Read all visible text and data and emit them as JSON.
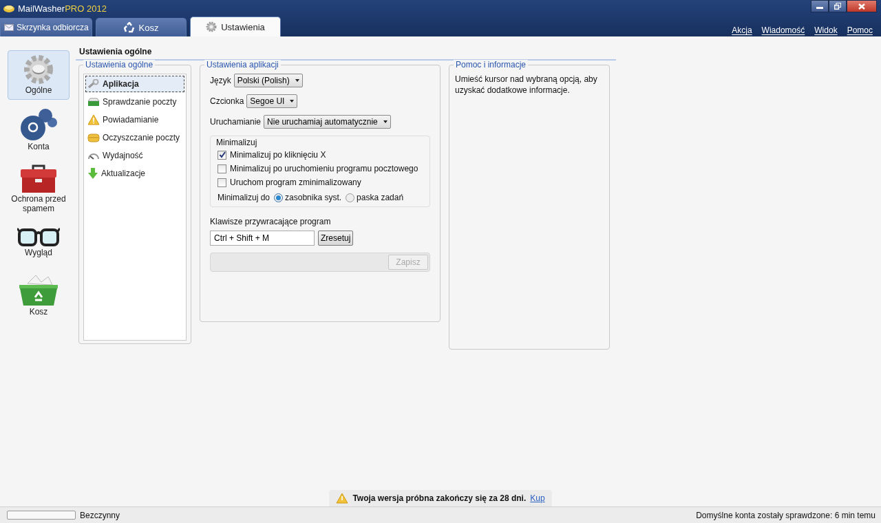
{
  "window": {
    "title_main": "MailWasher",
    "title_accent": "PRO 2012"
  },
  "tabs": [
    {
      "label": "Skrzynka odbiorcza",
      "selected": false
    },
    {
      "label": "Kosz",
      "selected": false
    },
    {
      "label": "Ustawienia",
      "selected": true
    }
  ],
  "menu": [
    "Akcja",
    "Wiadomość",
    "Widok",
    "Pomoc"
  ],
  "nav": [
    {
      "label": "Ogólne",
      "selected": true
    },
    {
      "label": "Konta",
      "selected": false
    },
    {
      "label": "Ochrona przed spamem",
      "selected": false
    },
    {
      "label": "Wygląd",
      "selected": false
    },
    {
      "label": "Kosz",
      "selected": false
    }
  ],
  "page_title": "Ustawienia ogólne",
  "categories": {
    "title": "Ustawienia ogólne",
    "items": [
      {
        "label": "Aplikacja",
        "selected": true
      },
      {
        "label": "Sprawdzanie poczty",
        "selected": false
      },
      {
        "label": "Powiadamianie",
        "selected": false
      },
      {
        "label": "Oczyszczanie poczty",
        "selected": false
      },
      {
        "label": "Wydajność",
        "selected": false
      },
      {
        "label": "Aktualizacje",
        "selected": false
      }
    ]
  },
  "app_settings": {
    "title": "Ustawienia aplikacji",
    "dropdowns": [
      {
        "label": "Język",
        "value": "Polski (Polish)"
      },
      {
        "label": "Czcionka",
        "value": "Segoe UI"
      },
      {
        "label": "Uruchamianie",
        "value": "Nie uruchamiaj automatycznie"
      }
    ],
    "minimize": {
      "title": "Minimalizuj",
      "checkboxes": [
        {
          "label": "Minimalizuj po kliknięciu X",
          "checked": true
        },
        {
          "label": "Minimalizuj po uruchomieniu programu pocztowego",
          "checked": false
        },
        {
          "label": "Uruchom program zminimalizowany",
          "checked": false
        }
      ],
      "radio_label": "Minimalizuj do",
      "radios": [
        {
          "label": "zasobnika syst.",
          "selected": true
        },
        {
          "label": "paska zadań",
          "selected": false
        }
      ]
    },
    "hotkey_label": "Klawisze przywracające program",
    "hotkey_value": "Ctrl + Shift + M",
    "reset_button": "Zresetuj",
    "save_button": {
      "label": "Zapisz",
      "disabled": true
    }
  },
  "help": {
    "title": "Pomoc i informacje",
    "text": "Umieść kursor nad wybraną opcją, aby uzyskać dodatkowe informacje."
  },
  "trial": {
    "text": "Twoja wersja próbna zakończy się za 28 dni.",
    "link": "Kup"
  },
  "status_bar": {
    "progress": {
      "level": 0
    },
    "status": "Bezczynny",
    "right": "Domyślne konta zostały sprawdzone: 6 min temu"
  }
}
